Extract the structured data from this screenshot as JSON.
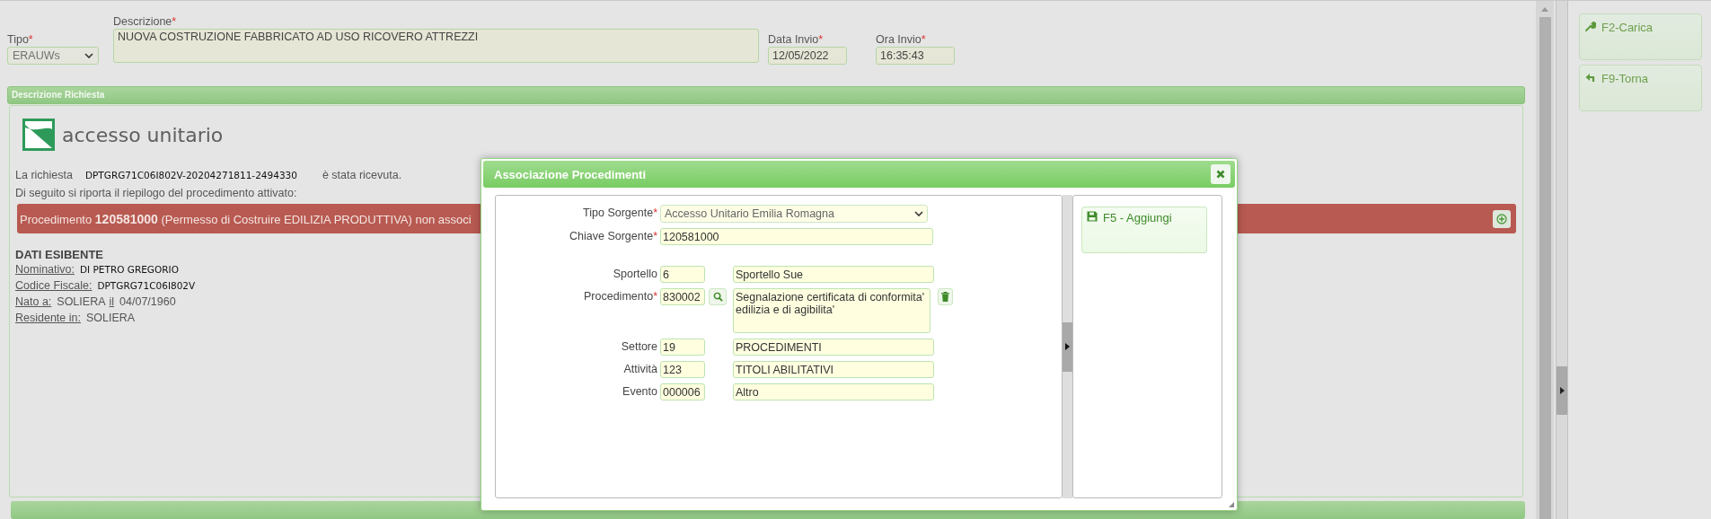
{
  "required_mark": "*",
  "header": {
    "tipo": {
      "label": "Tipo",
      "required": true,
      "value": "ERAUWs"
    },
    "descrizione": {
      "label": "Descrizione",
      "required": true,
      "value": "NUOVA COSTRUZIONE FABBRICATO AD USO RICOVERO ATTREZZI"
    },
    "data_invio": {
      "label": "Data Invio",
      "required": true,
      "value": "12/05/2022"
    },
    "ora_invio": {
      "label": "Ora Invio",
      "required": true,
      "value": "16:35:43"
    }
  },
  "section_title": "Descrizione Richiesta",
  "logo_text": "accesso unitario",
  "request": {
    "prefix": "La richiesta",
    "code": "DPTGRG71C06I802V-20204271811-2494330",
    "suffix": "è stata ricevuta."
  },
  "summary": "Di seguito si riporta il riepilogo del procedimento attivato:",
  "alert": "Procedimento **120581000** (Permesso di Costruire EDILIZIA PRODUTTIVA) non associ",
  "applicant": {
    "title": "DATI ESIBENTE",
    "fields": [
      {
        "kind": "code",
        "label": "Nominativo:",
        "value": "DI PETRO GREGORIO"
      },
      {
        "kind": "code",
        "label": "Codice Fiscale:",
        "value": "DPTGRG71C06I802V"
      },
      {
        "kind": "plain",
        "label": "Nato a:",
        "value": "SOLIERA",
        "label_2": "il",
        "value_2": "04/07/1960"
      },
      {
        "kind": "plain",
        "label": "Residente in:",
        "value": "SOLIERA"
      }
    ]
  },
  "modal": {
    "title": "Associazione Procedimenti",
    "rows": [
      {
        "kind": "select",
        "label": "Tipo Sorgente",
        "required": true,
        "value": "Accesso Unitario Emilia Romagna"
      },
      {
        "kind": "text",
        "label": "Chiave Sorgente",
        "required": true,
        "value": "120581000"
      },
      {
        "kind": "gap"
      },
      {
        "kind": "pair",
        "label": "Sportello",
        "required": false,
        "code": "6",
        "description": "Sportello Sue"
      },
      {
        "kind": "lookup",
        "label": "Procedimento",
        "required": true,
        "code": "830002",
        "description": "Segnalazione certificata di conformita' edilizia e di agibilita'"
      },
      {
        "kind": "pair",
        "label": "Settore",
        "required": false,
        "code": "19",
        "description": "PROCEDIMENTI"
      },
      {
        "kind": "pair",
        "label": "Attività",
        "required": false,
        "code": "123",
        "description": "TITOLI ABILITATIVI"
      },
      {
        "kind": "pair",
        "label": "Evento",
        "required": false,
        "code": "000006",
        "description": "Altro"
      }
    ],
    "actions": [
      {
        "label": "F5 - Aggiungi"
      }
    ]
  },
  "sidebar": [
    {
      "kind": "load",
      "label": "F2-Carica"
    },
    {
      "kind": "back",
      "label": "F9-Torna"
    }
  ]
}
